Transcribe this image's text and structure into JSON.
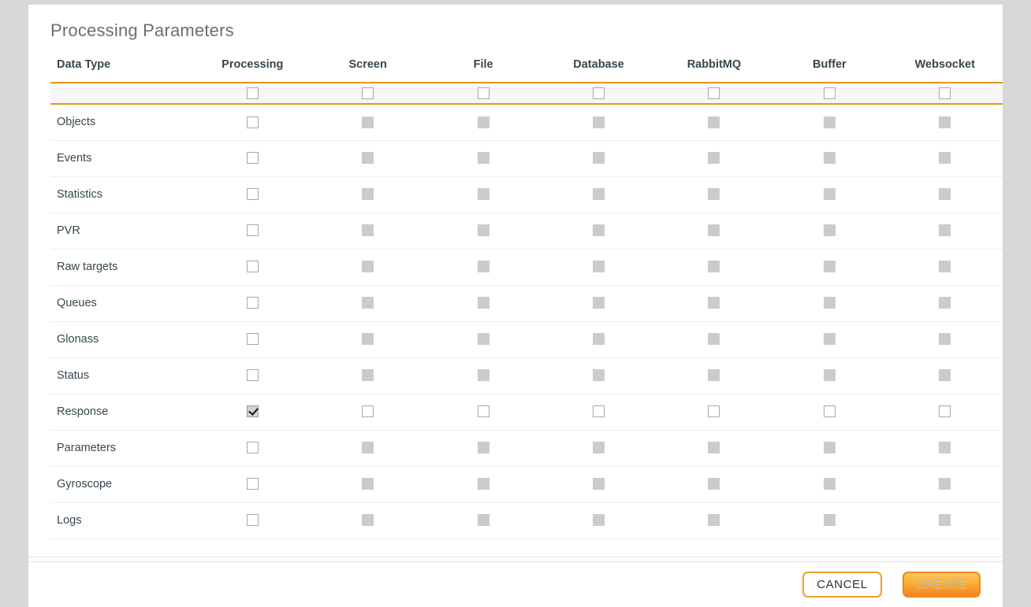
{
  "dialog": {
    "title": "Processing Parameters"
  },
  "table": {
    "columns": [
      {
        "key": "data_type",
        "label": "Data Type"
      },
      {
        "key": "processing",
        "label": "Processing"
      },
      {
        "key": "screen",
        "label": "Screen"
      },
      {
        "key": "file",
        "label": "File"
      },
      {
        "key": "database",
        "label": "Database"
      },
      {
        "key": "rabbitmq",
        "label": "RabbitMQ"
      },
      {
        "key": "buffer",
        "label": "Buffer"
      },
      {
        "key": "websocket",
        "label": "Websocket"
      }
    ],
    "select_all_row": {
      "name": "select-all-row",
      "cells": [
        {
          "state": "unchecked",
          "enabled": true
        },
        {
          "state": "unchecked",
          "enabled": true
        },
        {
          "state": "unchecked",
          "enabled": true
        },
        {
          "state": "unchecked",
          "enabled": true
        },
        {
          "state": "unchecked",
          "enabled": true
        },
        {
          "state": "unchecked",
          "enabled": true
        },
        {
          "state": "unchecked",
          "enabled": true
        }
      ]
    },
    "rows": [
      {
        "label": "Objects",
        "cells": [
          {
            "state": "unchecked",
            "enabled": true
          },
          {
            "state": "unchecked",
            "enabled": false
          },
          {
            "state": "unchecked",
            "enabled": false
          },
          {
            "state": "unchecked",
            "enabled": false
          },
          {
            "state": "unchecked",
            "enabled": false
          },
          {
            "state": "unchecked",
            "enabled": false
          },
          {
            "state": "unchecked",
            "enabled": false
          }
        ]
      },
      {
        "label": "Events",
        "cells": [
          {
            "state": "unchecked",
            "enabled": true
          },
          {
            "state": "unchecked",
            "enabled": false
          },
          {
            "state": "unchecked",
            "enabled": false
          },
          {
            "state": "unchecked",
            "enabled": false
          },
          {
            "state": "unchecked",
            "enabled": false
          },
          {
            "state": "unchecked",
            "enabled": false
          },
          {
            "state": "unchecked",
            "enabled": false
          }
        ]
      },
      {
        "label": "Statistics",
        "cells": [
          {
            "state": "unchecked",
            "enabled": true
          },
          {
            "state": "unchecked",
            "enabled": false
          },
          {
            "state": "unchecked",
            "enabled": false
          },
          {
            "state": "unchecked",
            "enabled": false
          },
          {
            "state": "unchecked",
            "enabled": false
          },
          {
            "state": "unchecked",
            "enabled": false
          },
          {
            "state": "unchecked",
            "enabled": false
          }
        ]
      },
      {
        "label": "PVR",
        "cells": [
          {
            "state": "unchecked",
            "enabled": true
          },
          {
            "state": "unchecked",
            "enabled": false
          },
          {
            "state": "unchecked",
            "enabled": false
          },
          {
            "state": "unchecked",
            "enabled": false
          },
          {
            "state": "unchecked",
            "enabled": false
          },
          {
            "state": "unchecked",
            "enabled": false
          },
          {
            "state": "unchecked",
            "enabled": false
          }
        ]
      },
      {
        "label": "Raw targets",
        "cells": [
          {
            "state": "unchecked",
            "enabled": true
          },
          {
            "state": "unchecked",
            "enabled": false
          },
          {
            "state": "unchecked",
            "enabled": false
          },
          {
            "state": "unchecked",
            "enabled": false
          },
          {
            "state": "unchecked",
            "enabled": false
          },
          {
            "state": "unchecked",
            "enabled": false
          },
          {
            "state": "unchecked",
            "enabled": false
          }
        ]
      },
      {
        "label": "Queues",
        "cells": [
          {
            "state": "unchecked",
            "enabled": true
          },
          {
            "state": "unchecked",
            "enabled": false
          },
          {
            "state": "unchecked",
            "enabled": false
          },
          {
            "state": "unchecked",
            "enabled": false
          },
          {
            "state": "unchecked",
            "enabled": false
          },
          {
            "state": "unchecked",
            "enabled": false
          },
          {
            "state": "unchecked",
            "enabled": false
          }
        ]
      },
      {
        "label": "Glonass",
        "cells": [
          {
            "state": "unchecked",
            "enabled": true
          },
          {
            "state": "unchecked",
            "enabled": false
          },
          {
            "state": "unchecked",
            "enabled": false
          },
          {
            "state": "unchecked",
            "enabled": false
          },
          {
            "state": "unchecked",
            "enabled": false
          },
          {
            "state": "unchecked",
            "enabled": false
          },
          {
            "state": "unchecked",
            "enabled": false
          }
        ]
      },
      {
        "label": "Status",
        "cells": [
          {
            "state": "unchecked",
            "enabled": true
          },
          {
            "state": "unchecked",
            "enabled": false
          },
          {
            "state": "unchecked",
            "enabled": false
          },
          {
            "state": "unchecked",
            "enabled": false
          },
          {
            "state": "unchecked",
            "enabled": false
          },
          {
            "state": "unchecked",
            "enabled": false
          },
          {
            "state": "unchecked",
            "enabled": false
          }
        ]
      },
      {
        "label": "Response",
        "cells": [
          {
            "state": "checked",
            "enabled": true
          },
          {
            "state": "unchecked",
            "enabled": true
          },
          {
            "state": "unchecked",
            "enabled": true
          },
          {
            "state": "unchecked",
            "enabled": true
          },
          {
            "state": "unchecked",
            "enabled": true
          },
          {
            "state": "unchecked",
            "enabled": true
          },
          {
            "state": "unchecked",
            "enabled": true
          }
        ]
      },
      {
        "label": "Parameters",
        "cells": [
          {
            "state": "unchecked",
            "enabled": true
          },
          {
            "state": "unchecked",
            "enabled": false
          },
          {
            "state": "unchecked",
            "enabled": false
          },
          {
            "state": "unchecked",
            "enabled": false
          },
          {
            "state": "unchecked",
            "enabled": false
          },
          {
            "state": "unchecked",
            "enabled": false
          },
          {
            "state": "unchecked",
            "enabled": false
          }
        ]
      },
      {
        "label": "Gyroscope",
        "cells": [
          {
            "state": "unchecked",
            "enabled": true
          },
          {
            "state": "unchecked",
            "enabled": false
          },
          {
            "state": "unchecked",
            "enabled": false
          },
          {
            "state": "unchecked",
            "enabled": false
          },
          {
            "state": "unchecked",
            "enabled": false
          },
          {
            "state": "unchecked",
            "enabled": false
          },
          {
            "state": "unchecked",
            "enabled": false
          }
        ]
      },
      {
        "label": "Logs",
        "cells": [
          {
            "state": "unchecked",
            "enabled": true
          },
          {
            "state": "unchecked",
            "enabled": false
          },
          {
            "state": "unchecked",
            "enabled": false
          },
          {
            "state": "unchecked",
            "enabled": false
          },
          {
            "state": "unchecked",
            "enabled": false
          },
          {
            "state": "unchecked",
            "enabled": false
          },
          {
            "state": "unchecked",
            "enabled": false
          }
        ]
      }
    ]
  },
  "footer": {
    "cancel_label": "CANCEL",
    "create_label": "CREATE",
    "create_disabled": true
  },
  "colors": {
    "accent_orange": "#e8941a",
    "button_border_orange": "#f0a028",
    "create_gradient_top": "#fcc65a",
    "create_gradient_bottom": "#f4841f",
    "header_text": "#37474f",
    "title_text": "#6e6e6e",
    "page_background": "#d8d8d8",
    "select_all_background": "#f7f7f7",
    "disabled_checkbox": "#cbcbcb"
  }
}
